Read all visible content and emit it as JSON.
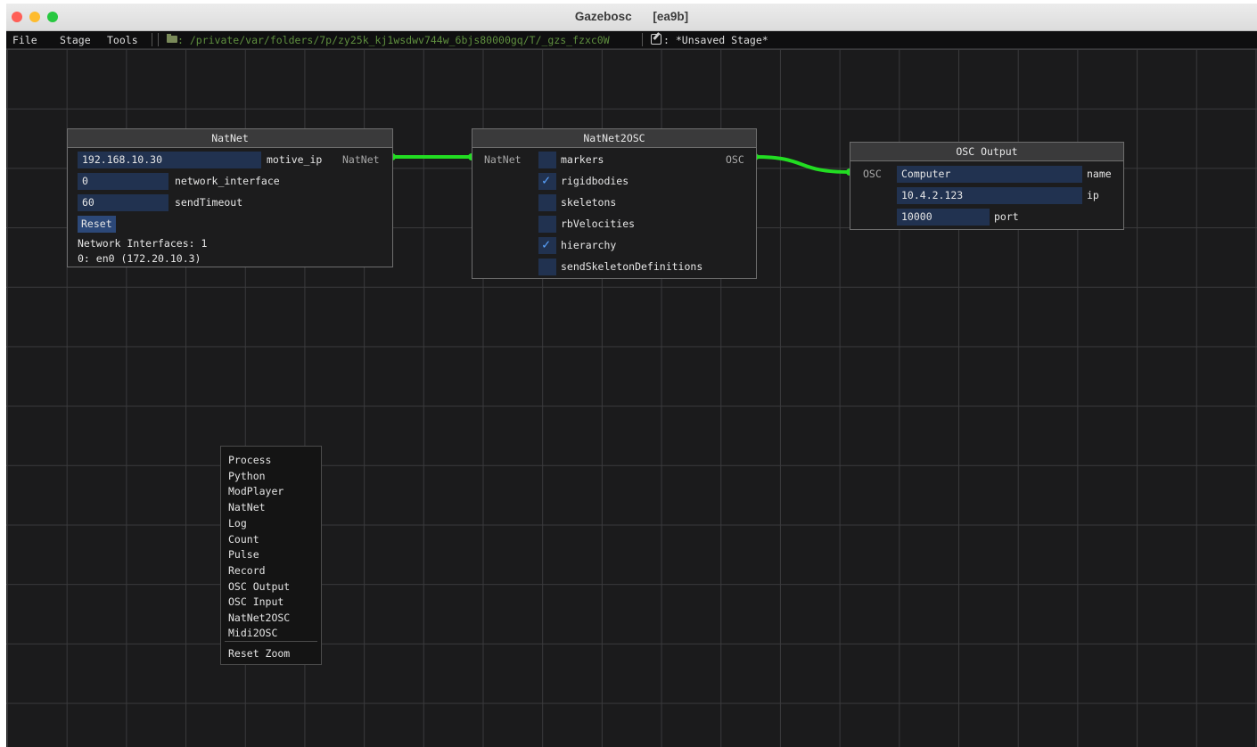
{
  "window": {
    "title": "Gazebosc",
    "id": "[ea9b]"
  },
  "menubar": {
    "file": "File",
    "stage": "Stage",
    "tools": "Tools",
    "path": ": /private/var/folders/7p/zy25k_kj1wsdwv744w_6bjs80000gq/T/_gzs_fzxc0W",
    "stage_name": ": *Unsaved Stage*"
  },
  "nodes": {
    "natnet": {
      "title": "NatNet",
      "motive_ip_value": "192.168.10.30",
      "motive_ip_label": "motive_ip",
      "network_interface_value": "0",
      "network_interface_label": "network_interface",
      "send_timeout_value": "60",
      "send_timeout_label": "sendTimeout",
      "reset_label": "Reset",
      "interfaces_count": "Network Interfaces: 1",
      "interface_0": "0: en0 (172.20.10.3)",
      "output_pin": "NatNet"
    },
    "natnet2osc": {
      "title": "NatNet2OSC",
      "input_pin": "NatNet",
      "output_pin": "OSC",
      "options": [
        {
          "label": "markers",
          "checked": false
        },
        {
          "label": "rigidbodies",
          "checked": true
        },
        {
          "label": "skeletons",
          "checked": false
        },
        {
          "label": "rbVelocities",
          "checked": false
        },
        {
          "label": "hierarchy",
          "checked": true
        },
        {
          "label": "sendSkeletonDefinitions",
          "checked": false
        }
      ]
    },
    "osc_output": {
      "title": "OSC Output",
      "input_pin": "OSC",
      "name_value": "Computer",
      "name_label": "name",
      "ip_value": "10.4.2.123",
      "ip_label": "ip",
      "port_value": "10000",
      "port_label": "port"
    }
  },
  "link_color": "#22dd22",
  "context_menu": {
    "items": [
      "Process",
      "Python",
      "ModPlayer",
      "NatNet",
      "Log",
      "Count",
      "Pulse",
      "Record",
      "OSC Output",
      "OSC Input",
      "NatNet2OSC",
      "Midi2OSC"
    ],
    "reset_zoom": "Reset Zoom"
  }
}
